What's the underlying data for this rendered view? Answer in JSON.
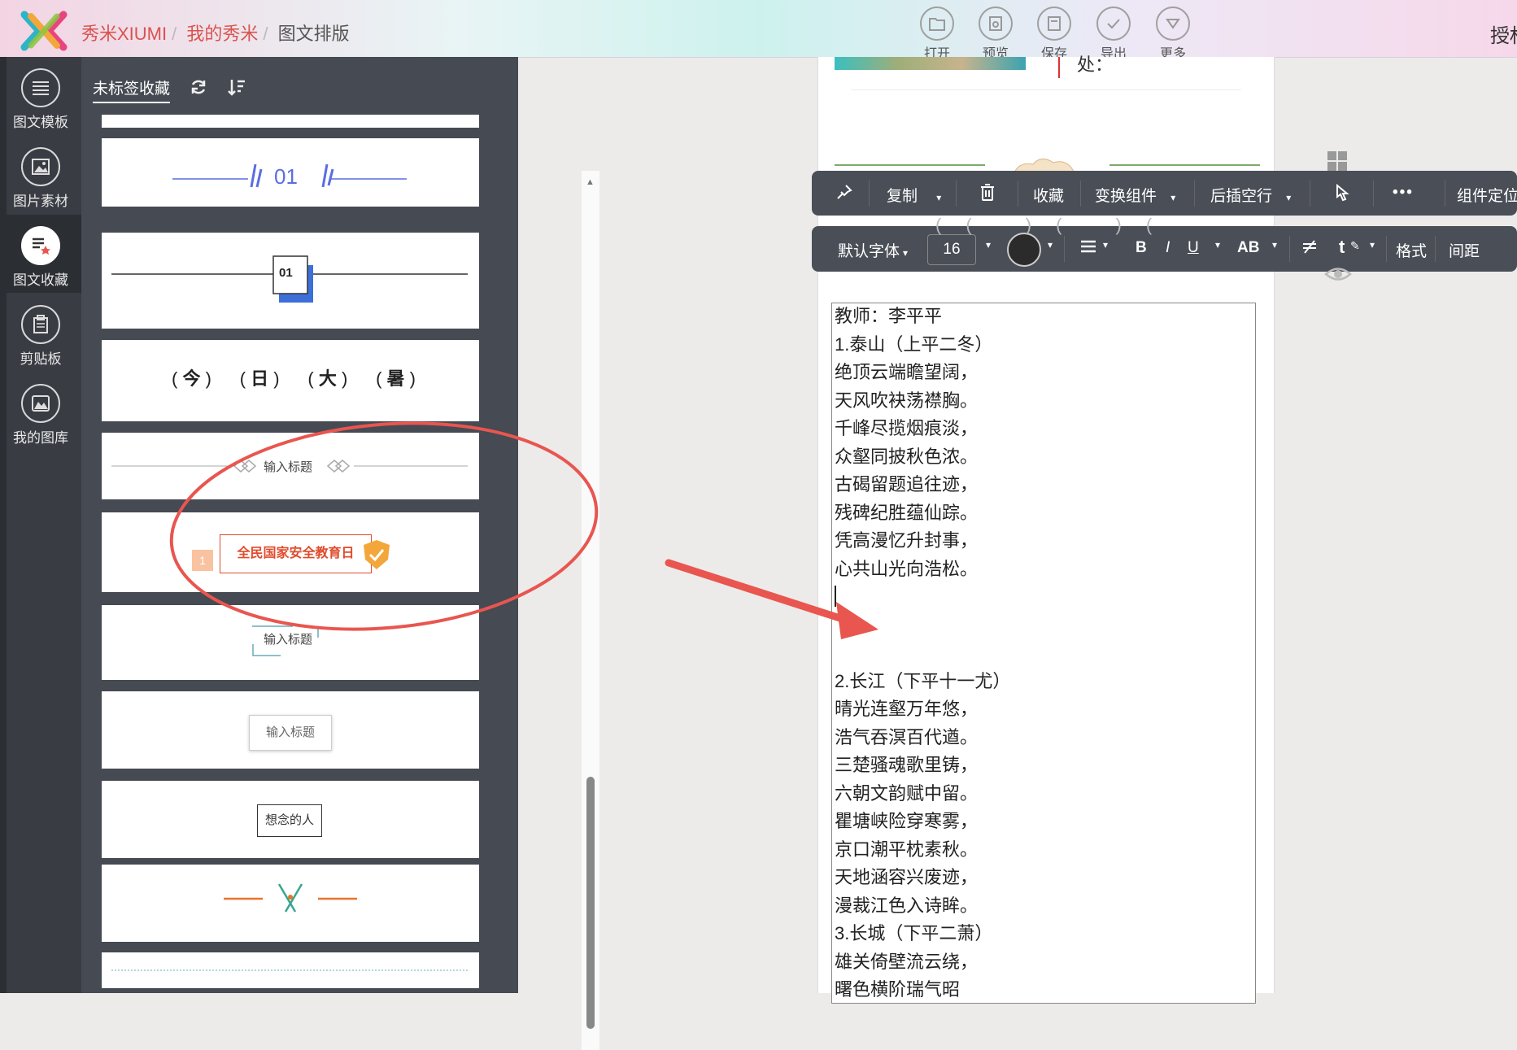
{
  "header": {
    "breadcrumb": [
      "秀米XIUMI",
      "我的秀米",
      "图文排版"
    ],
    "buttons": [
      "打开",
      "预览",
      "保存",
      "导出",
      "更多"
    ],
    "auth_text": "授权"
  },
  "rail": {
    "items": [
      "图文模板",
      "图片素材",
      "图文收藏",
      "剪贴板",
      "我的图库"
    ],
    "active": "图文收藏"
  },
  "panel": {
    "tab": "未标签收藏",
    "cards": {
      "num_01": "01",
      "box_01": "01",
      "chars": [
        "今",
        "日",
        "大",
        "暑"
      ],
      "title_diamond": "输入标题",
      "badge_text": "全民国家安全教育日",
      "badge_num": "1",
      "title_corner": "输入标题",
      "title_box": "输入标题",
      "miss": "想念的人"
    }
  },
  "toolbar1": {
    "copy": "复制",
    "favorite": "收藏",
    "switch": "变换组件",
    "insert_after": "后插空行",
    "more": "•••",
    "locate": "组件定位"
  },
  "toolbar2": {
    "font": "默认字体",
    "size": "16",
    "bold": "B",
    "italic": "I",
    "underline": "U",
    "case": "AB",
    "format": "格式",
    "spacing": "间距",
    "text_color": "#2b2b2b"
  },
  "editor": {
    "partial_top": "处：",
    "lines": [
      "教师：李平平",
      "1.泰山（上平二冬）",
      "绝顶云端瞻望阔，",
      "天风吹袂荡襟胸。",
      "千峰尽揽烟痕淡，",
      "众壑同披秋色浓。",
      "古碣留题追往迹，",
      "残碑纪胜蕴仙踪。",
      "凭高漫忆升封事，",
      "心共山光向浩松。",
      "",
      "",
      "",
      "2.长江（下平十一尤）",
      "晴光连壑万年悠，",
      "浩气吞溟百代遒。",
      "三楚骚魂歌里铸，",
      "六朝文韵赋中留。",
      "瞿塘峡险穿寒雾，",
      "京口潮平枕素秋。",
      "天地涵容兴废迹，",
      "漫裁江色入诗眸。",
      "3.长城（下平二萧）",
      "雄关倚壁流云绕，",
      "曙色横阶瑞气昭"
    ]
  },
  "annotation_color": "#e8564f"
}
